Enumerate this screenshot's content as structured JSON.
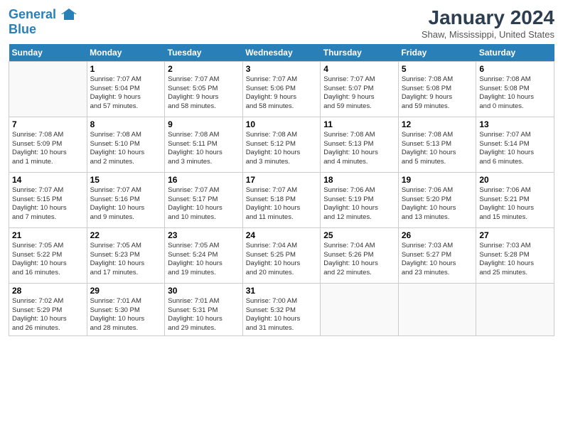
{
  "header": {
    "logo_line1": "General",
    "logo_line2": "Blue",
    "title": "January 2024",
    "subtitle": "Shaw, Mississippi, United States"
  },
  "days_of_week": [
    "Sunday",
    "Monday",
    "Tuesday",
    "Wednesday",
    "Thursday",
    "Friday",
    "Saturday"
  ],
  "weeks": [
    [
      {
        "day": "",
        "info": ""
      },
      {
        "day": "1",
        "info": "Sunrise: 7:07 AM\nSunset: 5:04 PM\nDaylight: 9 hours\nand 57 minutes."
      },
      {
        "day": "2",
        "info": "Sunrise: 7:07 AM\nSunset: 5:05 PM\nDaylight: 9 hours\nand 58 minutes."
      },
      {
        "day": "3",
        "info": "Sunrise: 7:07 AM\nSunset: 5:06 PM\nDaylight: 9 hours\nand 58 minutes."
      },
      {
        "day": "4",
        "info": "Sunrise: 7:07 AM\nSunset: 5:07 PM\nDaylight: 9 hours\nand 59 minutes."
      },
      {
        "day": "5",
        "info": "Sunrise: 7:08 AM\nSunset: 5:08 PM\nDaylight: 9 hours\nand 59 minutes."
      },
      {
        "day": "6",
        "info": "Sunrise: 7:08 AM\nSunset: 5:08 PM\nDaylight: 10 hours\nand 0 minutes."
      }
    ],
    [
      {
        "day": "7",
        "info": "Sunrise: 7:08 AM\nSunset: 5:09 PM\nDaylight: 10 hours\nand 1 minute."
      },
      {
        "day": "8",
        "info": "Sunrise: 7:08 AM\nSunset: 5:10 PM\nDaylight: 10 hours\nand 2 minutes."
      },
      {
        "day": "9",
        "info": "Sunrise: 7:08 AM\nSunset: 5:11 PM\nDaylight: 10 hours\nand 3 minutes."
      },
      {
        "day": "10",
        "info": "Sunrise: 7:08 AM\nSunset: 5:12 PM\nDaylight: 10 hours\nand 3 minutes."
      },
      {
        "day": "11",
        "info": "Sunrise: 7:08 AM\nSunset: 5:13 PM\nDaylight: 10 hours\nand 4 minutes."
      },
      {
        "day": "12",
        "info": "Sunrise: 7:08 AM\nSunset: 5:13 PM\nDaylight: 10 hours\nand 5 minutes."
      },
      {
        "day": "13",
        "info": "Sunrise: 7:07 AM\nSunset: 5:14 PM\nDaylight: 10 hours\nand 6 minutes."
      }
    ],
    [
      {
        "day": "14",
        "info": "Sunrise: 7:07 AM\nSunset: 5:15 PM\nDaylight: 10 hours\nand 7 minutes."
      },
      {
        "day": "15",
        "info": "Sunrise: 7:07 AM\nSunset: 5:16 PM\nDaylight: 10 hours\nand 9 minutes."
      },
      {
        "day": "16",
        "info": "Sunrise: 7:07 AM\nSunset: 5:17 PM\nDaylight: 10 hours\nand 10 minutes."
      },
      {
        "day": "17",
        "info": "Sunrise: 7:07 AM\nSunset: 5:18 PM\nDaylight: 10 hours\nand 11 minutes."
      },
      {
        "day": "18",
        "info": "Sunrise: 7:06 AM\nSunset: 5:19 PM\nDaylight: 10 hours\nand 12 minutes."
      },
      {
        "day": "19",
        "info": "Sunrise: 7:06 AM\nSunset: 5:20 PM\nDaylight: 10 hours\nand 13 minutes."
      },
      {
        "day": "20",
        "info": "Sunrise: 7:06 AM\nSunset: 5:21 PM\nDaylight: 10 hours\nand 15 minutes."
      }
    ],
    [
      {
        "day": "21",
        "info": "Sunrise: 7:05 AM\nSunset: 5:22 PM\nDaylight: 10 hours\nand 16 minutes."
      },
      {
        "day": "22",
        "info": "Sunrise: 7:05 AM\nSunset: 5:23 PM\nDaylight: 10 hours\nand 17 minutes."
      },
      {
        "day": "23",
        "info": "Sunrise: 7:05 AM\nSunset: 5:24 PM\nDaylight: 10 hours\nand 19 minutes."
      },
      {
        "day": "24",
        "info": "Sunrise: 7:04 AM\nSunset: 5:25 PM\nDaylight: 10 hours\nand 20 minutes."
      },
      {
        "day": "25",
        "info": "Sunrise: 7:04 AM\nSunset: 5:26 PM\nDaylight: 10 hours\nand 22 minutes."
      },
      {
        "day": "26",
        "info": "Sunrise: 7:03 AM\nSunset: 5:27 PM\nDaylight: 10 hours\nand 23 minutes."
      },
      {
        "day": "27",
        "info": "Sunrise: 7:03 AM\nSunset: 5:28 PM\nDaylight: 10 hours\nand 25 minutes."
      }
    ],
    [
      {
        "day": "28",
        "info": "Sunrise: 7:02 AM\nSunset: 5:29 PM\nDaylight: 10 hours\nand 26 minutes."
      },
      {
        "day": "29",
        "info": "Sunrise: 7:01 AM\nSunset: 5:30 PM\nDaylight: 10 hours\nand 28 minutes."
      },
      {
        "day": "30",
        "info": "Sunrise: 7:01 AM\nSunset: 5:31 PM\nDaylight: 10 hours\nand 29 minutes."
      },
      {
        "day": "31",
        "info": "Sunrise: 7:00 AM\nSunset: 5:32 PM\nDaylight: 10 hours\nand 31 minutes."
      },
      {
        "day": "",
        "info": ""
      },
      {
        "day": "",
        "info": ""
      },
      {
        "day": "",
        "info": ""
      }
    ]
  ]
}
